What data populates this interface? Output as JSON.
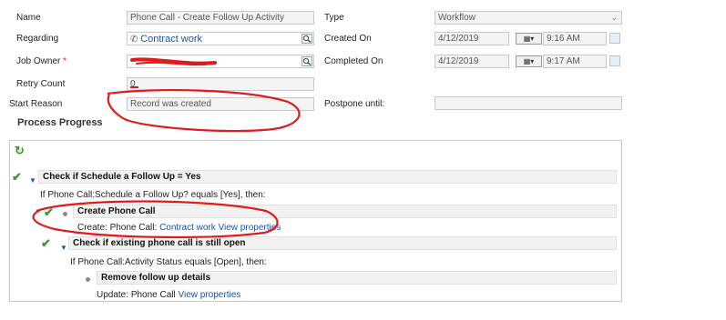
{
  "form": {
    "name_label": "Name",
    "name_value": "Phone Call - Create Follow Up Activity",
    "regarding_label": "Regarding",
    "regarding_value": "Contract work",
    "job_owner_label": "Job Owner",
    "job_owner_required": "*",
    "retry_count_label": "Retry Count",
    "retry_count_value": "0",
    "start_reason_label": "Start Reason",
    "start_reason_value": "Record was created",
    "type_label": "Type",
    "type_value": "Workflow",
    "created_on_label": "Created On",
    "created_on_date": "4/12/2019",
    "created_on_time": "9:16 AM",
    "completed_on_label": "Completed On",
    "completed_on_date": "4/12/2019",
    "completed_on_time": "9:17 AM",
    "postpone_label": "Postpone until:",
    "calendar_button": "▦▾"
  },
  "process": {
    "title": "Process Progress",
    "step1_title": "Check if Schedule a Follow Up = Yes",
    "step1_condition": "If Phone Call:Schedule a Follow Up? equals [Yes], then:",
    "step2_title": "Create Phone Call",
    "step2_action_prefix": "Create:",
    "step2_entity": "Phone Call:",
    "step2_link": "Contract work",
    "step2_view": "View properties",
    "step3_title": "Check if existing phone call is still open",
    "step3_condition": "If Phone Call:Activity Status equals [Open], then:",
    "step4_title": "Remove follow up details",
    "step4_action_prefix": "Update:",
    "step4_entity": "Phone Call",
    "step4_view": "View properties"
  },
  "colors": {
    "annotation": "#e01b1b",
    "link": "#1f4fa8",
    "success": "#3a9a2e"
  }
}
